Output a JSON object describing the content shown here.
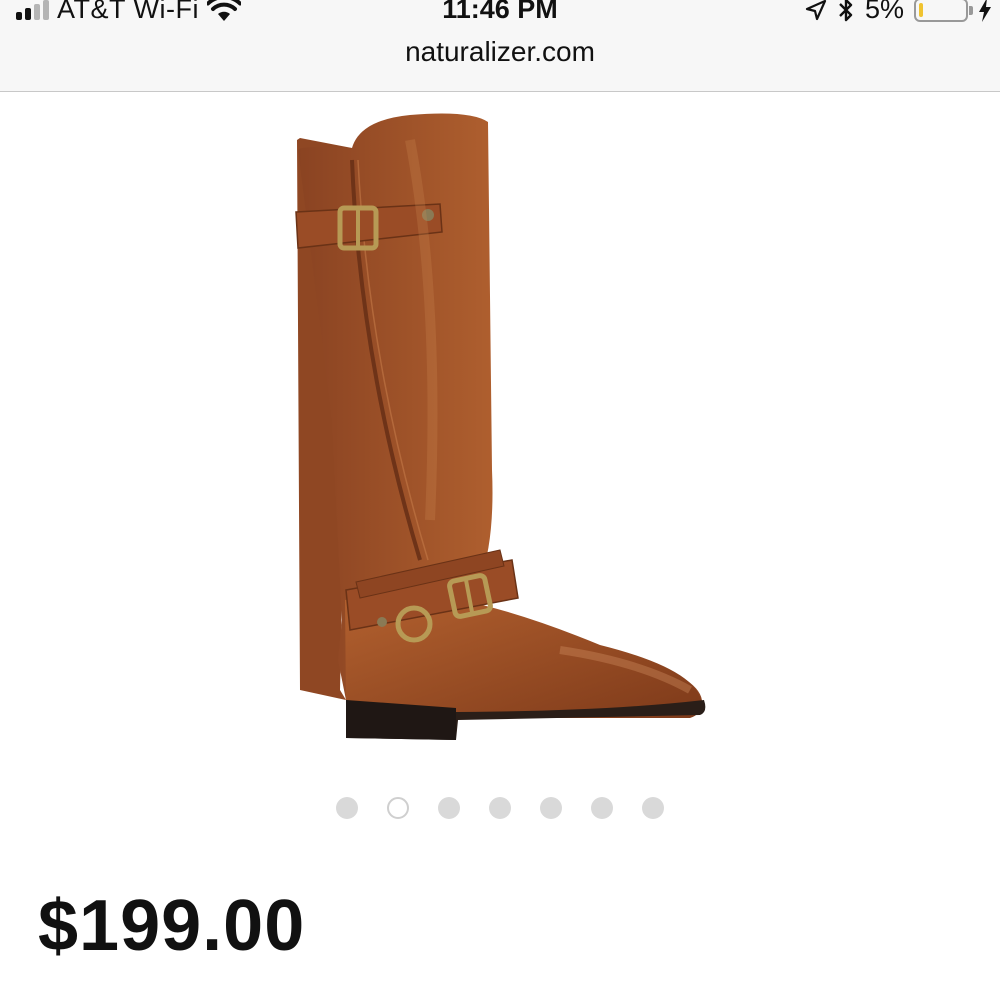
{
  "status_bar": {
    "carrier": "AT&T Wi-Fi",
    "time": "11:46 PM",
    "battery_percent": "5%",
    "battery_level": 0.05,
    "battery_color": "#f0c330",
    "icons": [
      "signal-icon",
      "wifi-icon",
      "location-arrow-icon",
      "bluetooth-icon",
      "battery-icon",
      "charging-bolt-icon"
    ]
  },
  "browser": {
    "url": "naturalizer.com"
  },
  "product": {
    "image_description_icon": "tall-brown-riding-boot-image",
    "boot_color": "#a0532c",
    "carousel": {
      "total": 7,
      "active_index": 1
    },
    "price": "$199.00"
  }
}
